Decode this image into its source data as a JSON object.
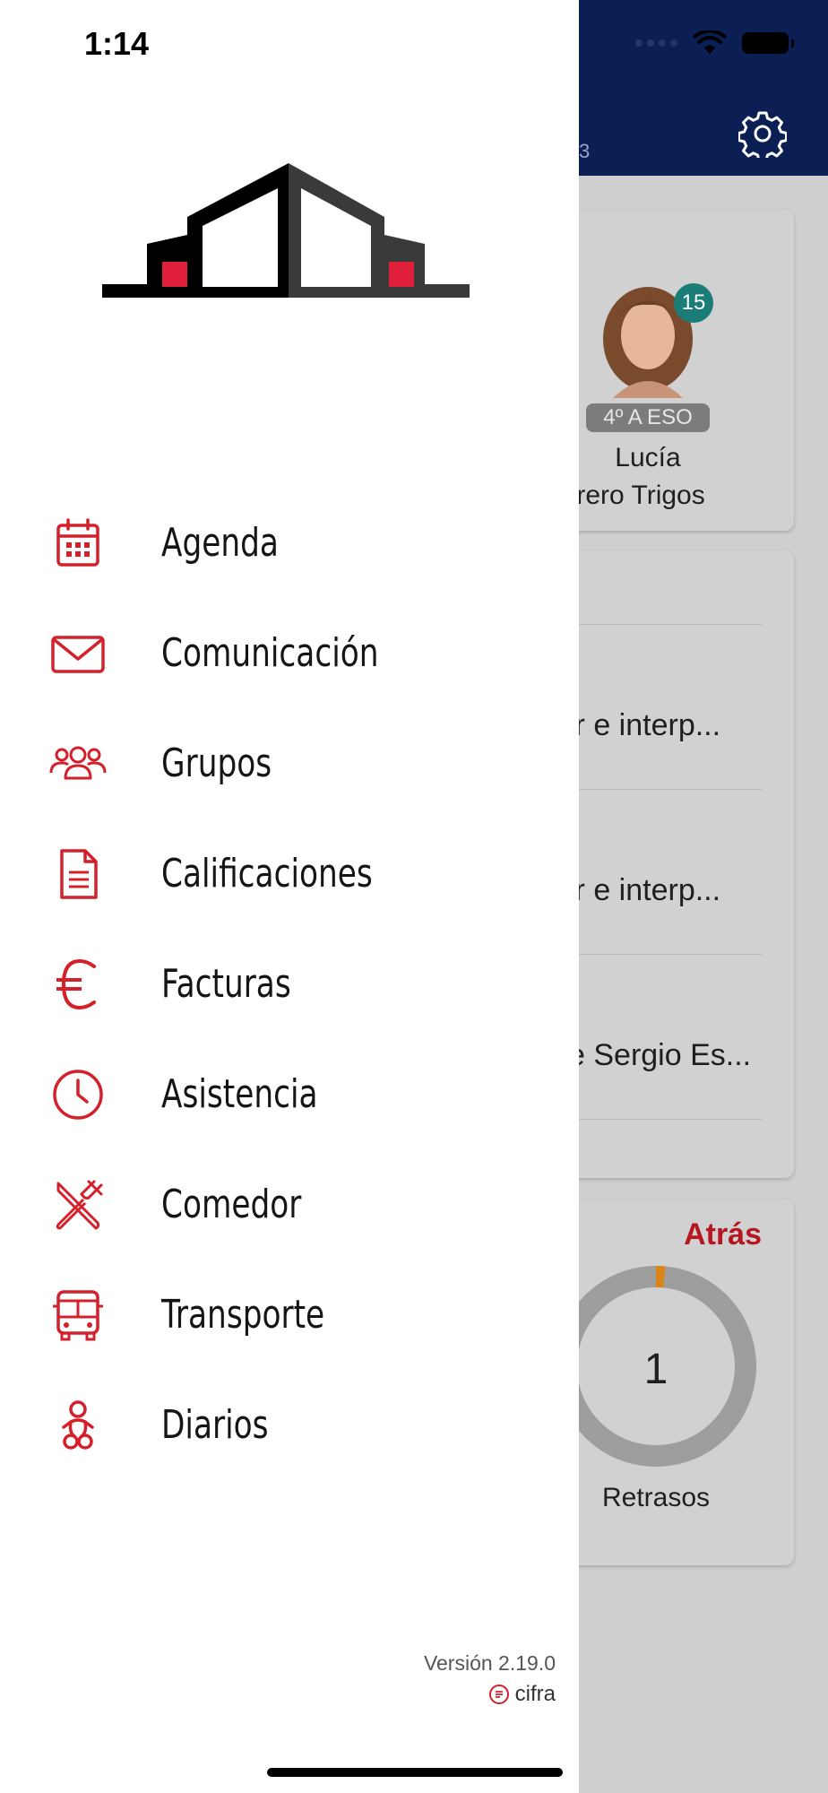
{
  "status_bar": {
    "time": "1:14"
  },
  "header": {
    "subtitle_fragment": "3"
  },
  "student": {
    "badge_count": "15",
    "group": "4º A ESO",
    "first_name": "Lucía",
    "last_name_fragment": "uerrero Trigos"
  },
  "messages": [
    {
      "text": "ir e interp..."
    },
    {
      "text": "ir e interp..."
    },
    {
      "text": "e Sergio Es..."
    }
  ],
  "attendance": {
    "back_label": "Atrás",
    "count": "1",
    "label": "Retrasos",
    "fill_fraction": 0.015
  },
  "menu": {
    "items": [
      {
        "label": "Agenda",
        "icon": "calendar-icon"
      },
      {
        "label": "Comunicación",
        "icon": "envelope-icon"
      },
      {
        "label": "Grupos",
        "icon": "group-icon"
      },
      {
        "label": "Calificaciones",
        "icon": "document-icon"
      },
      {
        "label": "Facturas",
        "icon": "euro-icon"
      },
      {
        "label": "Asistencia",
        "icon": "clock-icon"
      },
      {
        "label": "Comedor",
        "icon": "cutlery-icon"
      },
      {
        "label": "Transporte",
        "icon": "bus-icon"
      },
      {
        "label": "Diarios",
        "icon": "baby-icon"
      }
    ]
  },
  "footer": {
    "version": "Versión 2.19.0",
    "brand": "cifra"
  },
  "colors": {
    "accent": "#d4202a",
    "header_bg": "#0c1f55",
    "attendance_accent": "#d9851a"
  }
}
